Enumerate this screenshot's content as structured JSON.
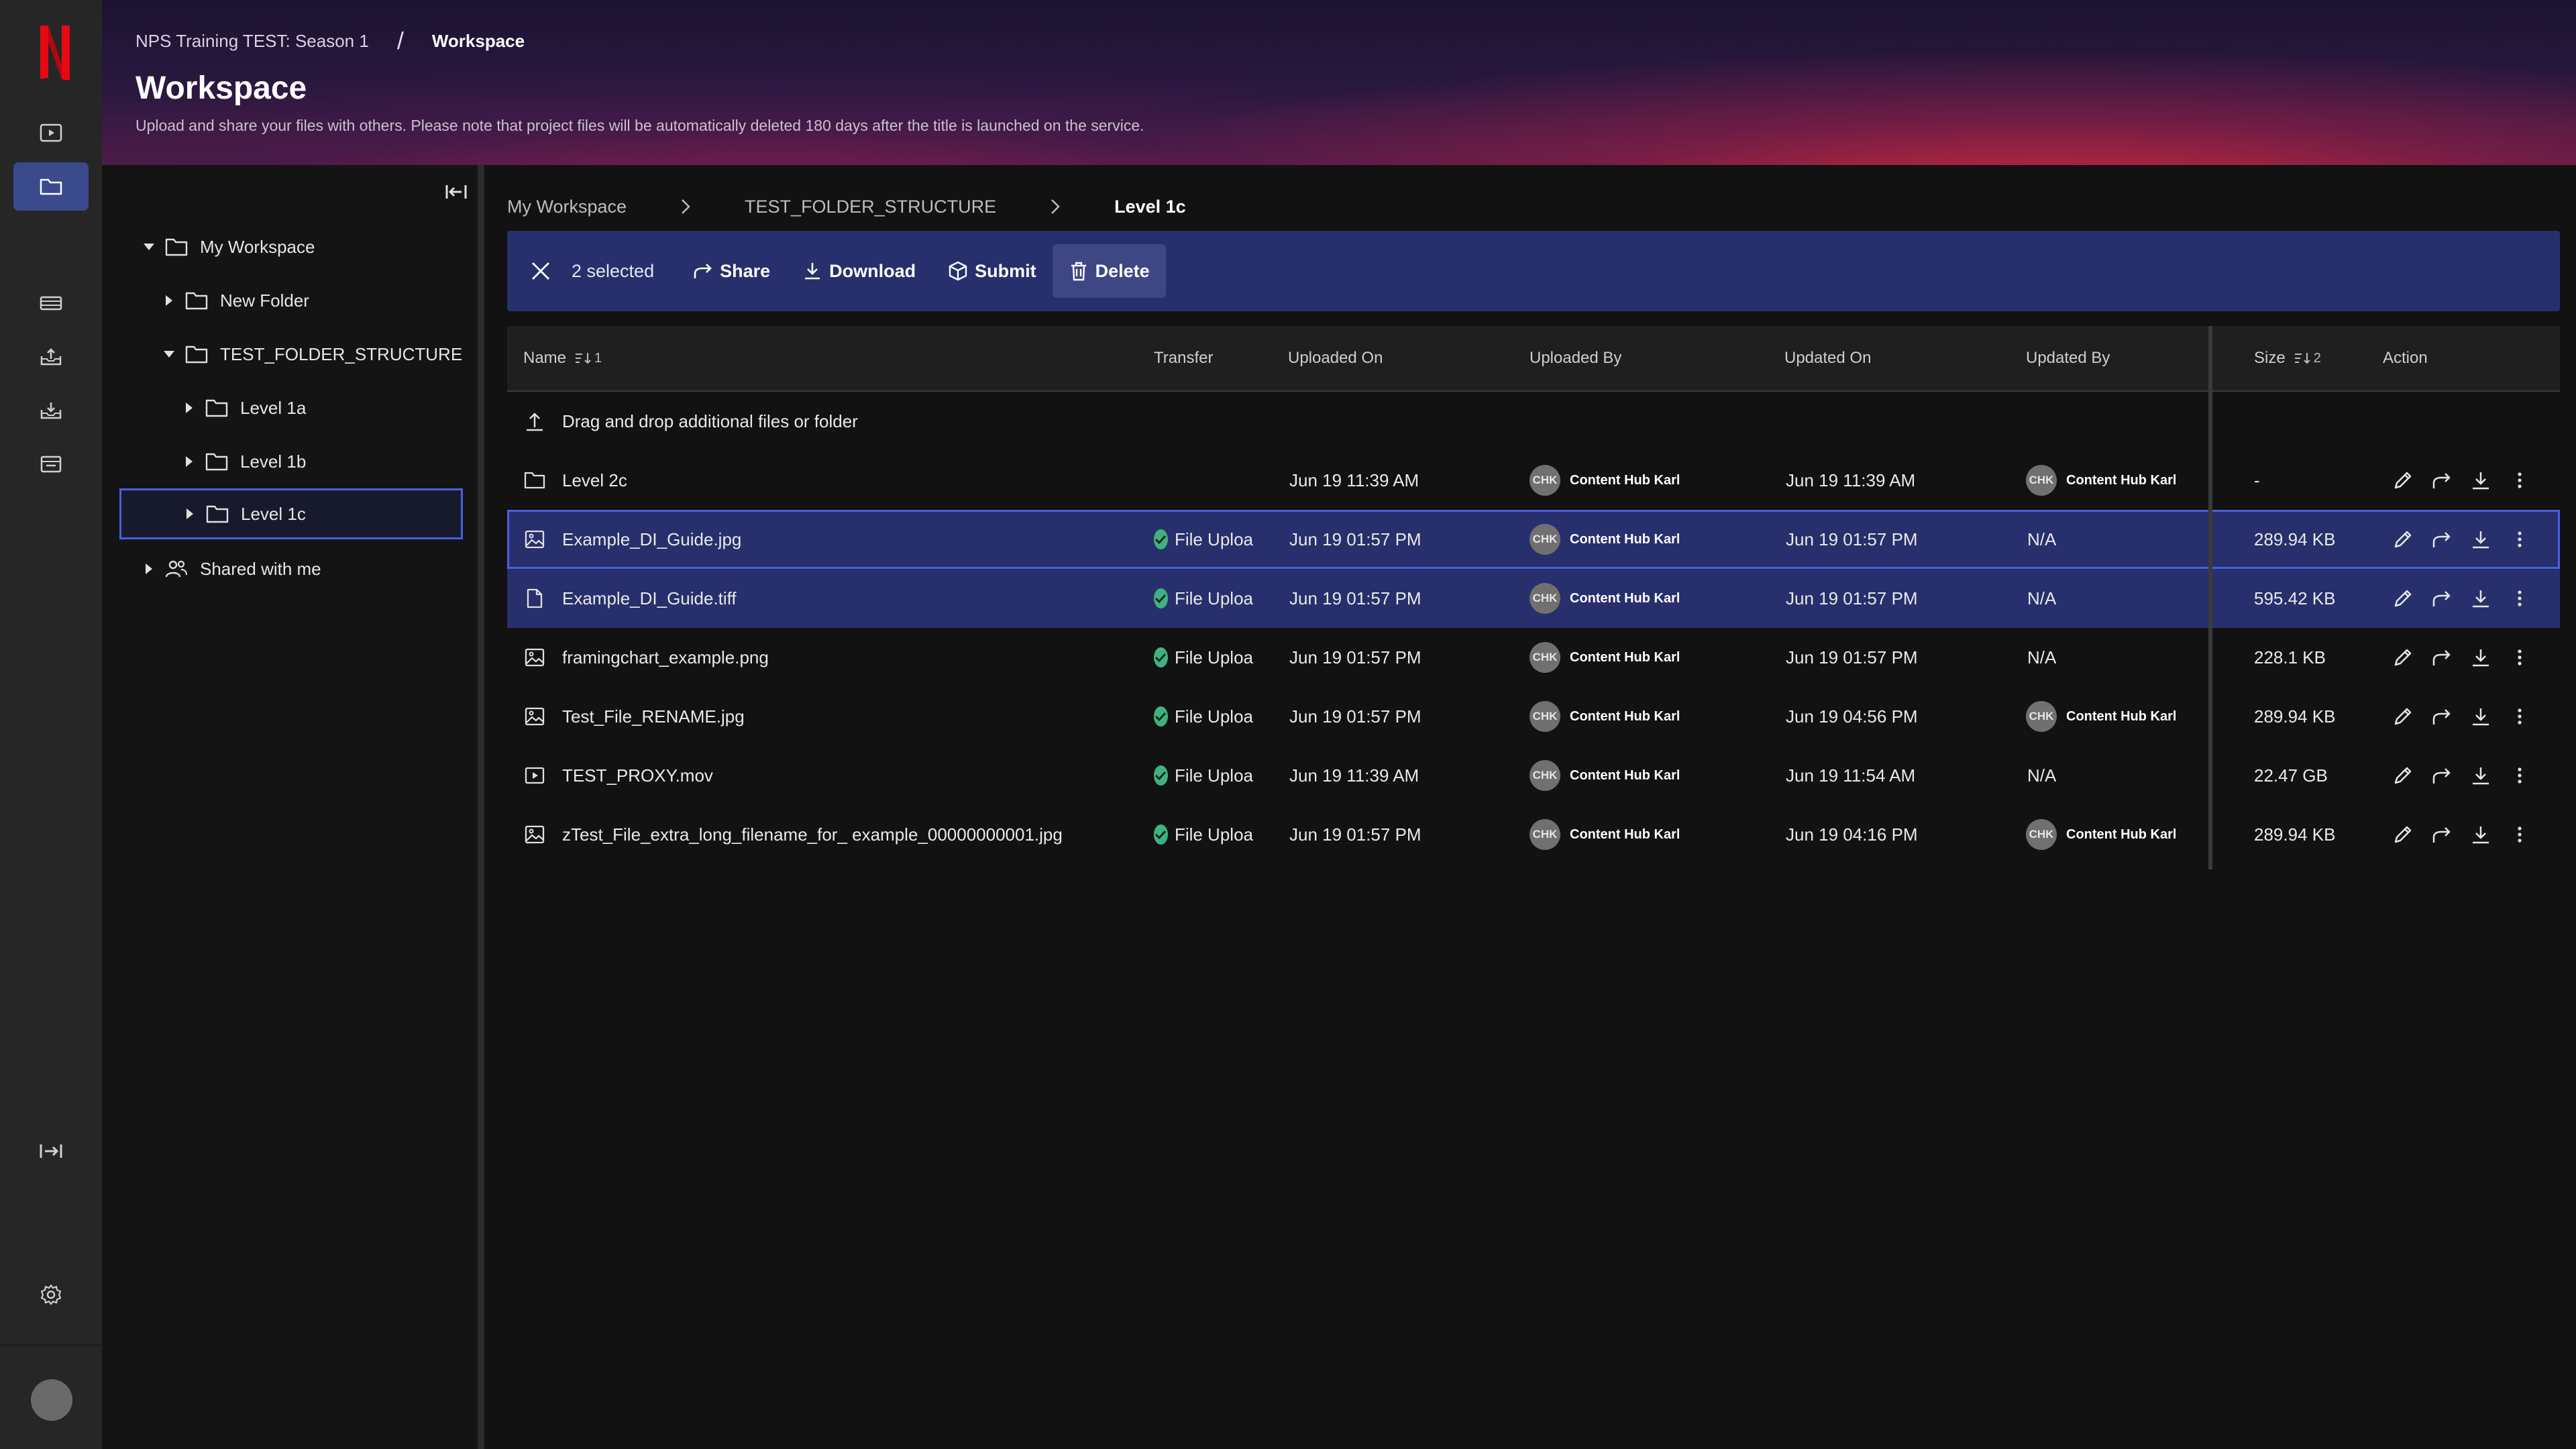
{
  "header": {
    "breadcrumb_project": "NPS Training TEST: Season 1",
    "breadcrumb_separator": "/",
    "breadcrumb_current": "Workspace",
    "title": "Workspace",
    "subtitle": "Upload and share your files with others. Please note that project files will be automatically deleted 180 days after the title is launched on the service."
  },
  "rail": {
    "logo_letter": "N",
    "brand_color": "#e50914",
    "active_item": "folder-icon"
  },
  "tree": {
    "items": [
      {
        "label": "My Workspace",
        "expanded": true
      },
      {
        "label": "New Folder",
        "expanded": false
      },
      {
        "label": "TEST_FOLDER_STRUCTURE",
        "expanded": true
      },
      {
        "label": "Level 1a",
        "expanded": false
      },
      {
        "label": "Level 1b",
        "expanded": false
      },
      {
        "label": "Level 1c",
        "expanded": false,
        "selected": true
      },
      {
        "label": "Shared with me",
        "expanded": false
      }
    ]
  },
  "breadcrumb": {
    "items": [
      "My Workspace",
      "TEST_FOLDER_STRUCTURE",
      "Level 1c"
    ]
  },
  "toolbar": {
    "selected_count": "2 selected",
    "share": "Share",
    "download": "Download",
    "submit": "Submit",
    "delete": "Delete"
  },
  "table": {
    "columns": {
      "name": "Name",
      "name_sort": "1",
      "transfer": "Transfer",
      "uploaded_on": "Uploaded On",
      "uploaded_by": "Uploaded By",
      "updated_on": "Updated On",
      "updated_by": "Updated By",
      "size": "Size",
      "size_sort": "2",
      "action": "Action"
    },
    "dropzone": "Drag and drop additional files or folder",
    "rows": [
      {
        "name": "Level 2c",
        "type": "folder-icon",
        "transfer": "",
        "uploaded_on": "Jun 19 11:39 AM",
        "uploaded_by_initials": "CHK",
        "uploaded_by": "Content Hub Karl",
        "updated_on": "Jun 19 11:39 AM",
        "updated_by_initials": "CHK",
        "updated_by": "Content Hub Karl",
        "updated_by_na": "",
        "size": "-",
        "selected": false
      },
      {
        "name": "Example_DI_Guide.jpg",
        "type": "image-icon",
        "transfer": "File Uploa",
        "uploaded_on": "Jun 19 01:57 PM",
        "uploaded_by_initials": "CHK",
        "uploaded_by": "Content Hub Karl",
        "updated_on": "Jun 19 01:57 PM",
        "updated_by_initials": "",
        "updated_by": "",
        "updated_by_na": "N/A",
        "size": "289.94 KB",
        "selected": true
      },
      {
        "name": "Example_DI_Guide.tiff",
        "type": "file-icon",
        "transfer": "File Uploa",
        "uploaded_on": "Jun 19 01:57 PM",
        "uploaded_by_initials": "CHK",
        "uploaded_by": "Content Hub Karl",
        "updated_on": "Jun 19 01:57 PM",
        "updated_by_initials": "",
        "updated_by": "",
        "updated_by_na": "N/A",
        "size": "595.42 KB",
        "selected": true
      },
      {
        "name": "framingchart_example.png",
        "type": "image-icon",
        "transfer": "File Uploa",
        "uploaded_on": "Jun 19 01:57 PM",
        "uploaded_by_initials": "CHK",
        "uploaded_by": "Content Hub Karl",
        "updated_on": "Jun 19 01:57 PM",
        "updated_by_initials": "",
        "updated_by": "",
        "updated_by_na": "N/A",
        "size": "228.1 KB",
        "selected": false
      },
      {
        "name": "Test_File_RENAME.jpg",
        "type": "image-icon",
        "transfer": "File Uploa",
        "uploaded_on": "Jun 19 01:57 PM",
        "uploaded_by_initials": "CHK",
        "uploaded_by": "Content Hub Karl",
        "updated_on": "Jun 19 04:56 PM",
        "updated_by_initials": "CHK",
        "updated_by": "Content Hub Karl",
        "updated_by_na": "",
        "size": "289.94 KB",
        "selected": false
      },
      {
        "name": "TEST_PROXY.mov",
        "type": "video-icon",
        "transfer": "File Uploa",
        "uploaded_on": "Jun 19 11:39 AM",
        "uploaded_by_initials": "CHK",
        "uploaded_by": "Content Hub Karl",
        "updated_on": "Jun 19 11:54 AM",
        "updated_by_initials": "",
        "updated_by": "",
        "updated_by_na": "N/A",
        "size": "22.47 GB",
        "selected": false
      },
      {
        "name": "zTest_File_extra_long_filename_for_ example_00000000001.jpg",
        "type": "image-icon",
        "transfer": "File Uploa",
        "uploaded_on": "Jun 19 01:57 PM",
        "uploaded_by_initials": "CHK",
        "uploaded_by": "Content Hub Karl",
        "updated_on": "Jun 19 04:16 PM",
        "updated_by_initials": "CHK",
        "updated_by": "Content Hub Karl",
        "updated_by_na": "",
        "size": "289.94 KB",
        "selected": false
      }
    ]
  },
  "colors": {
    "accent": "#4a5fe0",
    "selection": "#27306c",
    "success": "#3fb27f"
  }
}
